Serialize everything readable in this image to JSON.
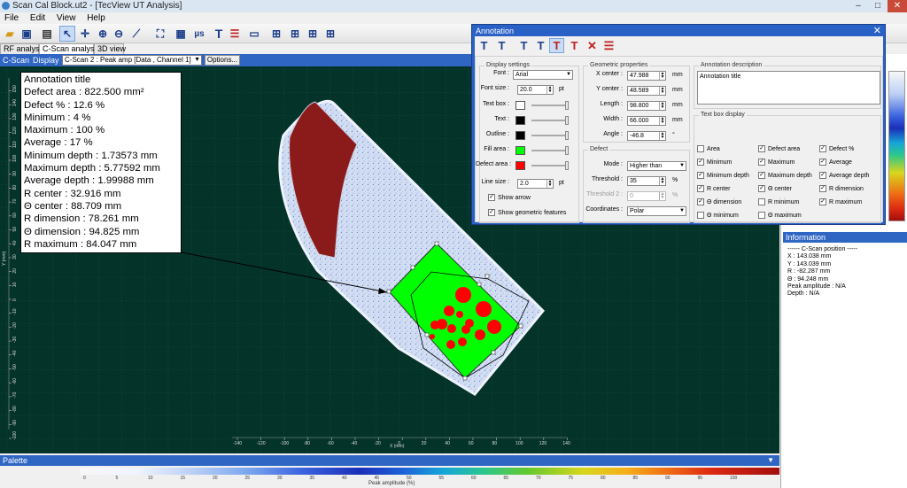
{
  "window": {
    "title": "Scan Cal Block.ut2 - [TecView UT Analysis]"
  },
  "menu": [
    "File",
    "Edit",
    "View",
    "Help"
  ],
  "tabs": [
    "RF analysis",
    "C-Scan analysis",
    "3D view"
  ],
  "cscan": {
    "title": "C-Scan",
    "display_label": "Display :",
    "display_value": "C-Scan 2 : Peak amp [Data , Channel 1]",
    "options_button": "Options...",
    "x_axis_title": "X (mm)",
    "y_axis_title": "Y (mm)",
    "x_ticks": [
      "-140",
      "-120",
      "-100",
      "-80",
      "-60",
      "-40",
      "-20",
      "0",
      "20",
      "40",
      "60",
      "80",
      "100",
      "120",
      "140"
    ],
    "y_ticks": [
      "-100",
      "-90",
      "-80",
      "-70",
      "-60",
      "-50",
      "-40",
      "-30",
      "-20",
      "-10",
      "0",
      "10",
      "20",
      "30",
      "40",
      "50",
      "60",
      "70",
      "80",
      "90",
      "100",
      "110",
      "120",
      "130",
      "140",
      "150"
    ]
  },
  "annotation_box": {
    "lines": [
      "Annotation title",
      "Defect area : 822.500 mm²",
      "Defect % : 12.6 %",
      "Minimum : 4 %",
      "Maximum : 100 %",
      "Average : 17 %",
      "Minimum depth : 1.73573 mm",
      "Maximum depth : 5.77592 mm",
      "Average depth : 1.99988 mm",
      "R center : 32.916 mm",
      "Θ center : 88.709 mm",
      "R dimension : 78.261 mm",
      "Θ dimension : 94.825 mm",
      "R maximum : 84.047 mm"
    ]
  },
  "palette": {
    "title": "Palette",
    "axis_label": "Peak amplitude (%)",
    "ticks": [
      "0",
      "5",
      "10",
      "15",
      "20",
      "25",
      "30",
      "35",
      "40",
      "45",
      "50",
      "55",
      "60",
      "65",
      "70",
      "75",
      "80",
      "85",
      "90",
      "95",
      "100"
    ]
  },
  "information": {
    "title": "Information",
    "lines": [
      "------ C-Scan position -----",
      "X : 143.038 mm",
      "Y : 143.039 mm",
      "R : -82.287 mm",
      "Θ : 94.248 mm",
      "Peak amplitude : N/A",
      "Depth : N/A"
    ]
  },
  "dialog": {
    "title": "Annotation",
    "display_settings": {
      "title": "Display settings",
      "font_label": "Font :",
      "font_value": "Arial",
      "font_size_label": "Font size :",
      "font_size_value": "20.0",
      "font_size_unit": "pt",
      "text_box_label": "Text box :",
      "text_label": "Text :",
      "outline_label": "Outline :",
      "fill_area_label": "Fill area :",
      "defect_area_label": "Defect area :",
      "line_size_label": "Line size :",
      "line_size_value": "2.0",
      "line_size_unit": "pt",
      "show_arrow": "Show arrow",
      "show_geometric": "Show geometric features"
    },
    "geometric": {
      "title": "Geometric properties",
      "x_center_label": "X center :",
      "x_center_value": "47.988",
      "y_center_label": "Y center :",
      "y_center_value": "48.589",
      "length_label": "Length :",
      "length_value": "98.800",
      "width_label": "Width :",
      "width_value": "66.000",
      "angle_label": "Angle :",
      "angle_value": "-46.8",
      "unit_mm": "mm",
      "unit_deg": "°"
    },
    "defect": {
      "title": "Defect",
      "mode_label": "Mode :",
      "mode_value": "Higher than",
      "threshold_label": "Threshold :",
      "threshold_value": "35",
      "threshold_unit": "%",
      "threshold2_label": "Threshold 2 :",
      "threshold2_value": "0",
      "threshold2_unit": "%",
      "coordinates_label": "Coordinates :",
      "coordinates_value": "Polar"
    },
    "description": {
      "title": "Annotation description",
      "value": "Annotation title"
    },
    "text_box_display": {
      "title": "Text box display",
      "items": [
        {
          "label": "Area",
          "checked": false
        },
        {
          "label": "Defect area",
          "checked": true
        },
        {
          "label": "Defect %",
          "checked": true
        },
        {
          "label": "Minimum",
          "checked": true
        },
        {
          "label": "Maximum",
          "checked": true
        },
        {
          "label": "Average",
          "checked": true
        },
        {
          "label": "Minimum depth",
          "checked": true
        },
        {
          "label": "Maximum depth",
          "checked": true
        },
        {
          "label": "Average depth",
          "checked": true
        },
        {
          "label": "R center",
          "checked": true
        },
        {
          "label": "Θ center",
          "checked": true
        },
        {
          "label": "R dimension",
          "checked": true
        },
        {
          "label": "Θ dimension",
          "checked": true
        },
        {
          "label": "R minimum",
          "checked": false
        },
        {
          "label": "R maximum",
          "checked": true
        },
        {
          "label": "Θ minimum",
          "checked": false
        },
        {
          "label": "Θ maximum",
          "checked": false
        }
      ]
    }
  },
  "colors": {
    "text_box": "#ffffff",
    "text": "#000000",
    "outline": "#000000",
    "fill_area": "#00ff00",
    "defect_area": "#ff0000"
  }
}
